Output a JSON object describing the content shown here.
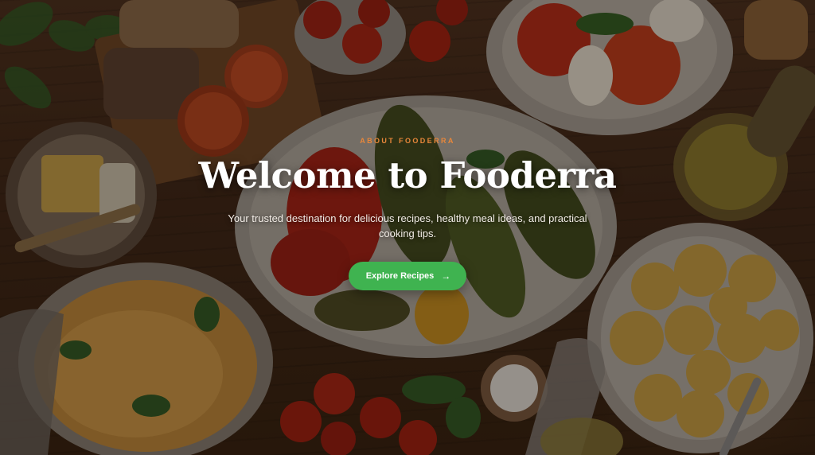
{
  "hero": {
    "eyebrow": "ABOUT FOODERRA",
    "title": "Welcome to Fooderra",
    "subtitle": "Your trusted destination for delicious recipes, healthy meal ideas, and practical cooking tips.",
    "cta_label": "Explore Recipes",
    "cta_icon": "arrow-right-icon",
    "background_image": "food-table-spread-photo"
  },
  "colors": {
    "eyebrow": "#e8873a",
    "title": "#ffffff",
    "subtitle": "#f2ece6",
    "button": "#3fb350",
    "button_text": "#ffffff",
    "overlay": "#120a06"
  }
}
